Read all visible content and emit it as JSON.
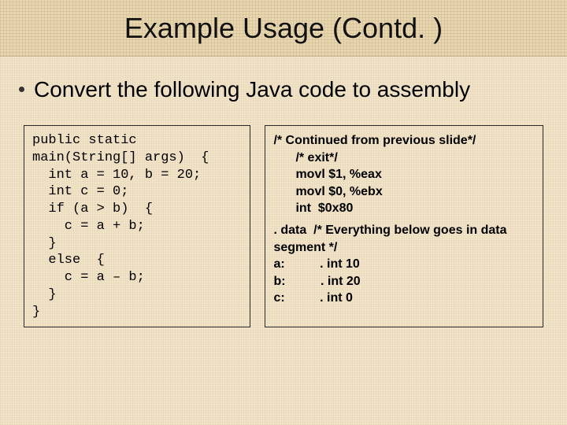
{
  "title": "Example Usage (Contd. )",
  "bullet": "Convert the following Java code to assembly",
  "leftCode": "public static\nmain(String[] args)  {\n  int a = 10, b = 20;\n  int c = 0;\n  if (a > b)  {\n    c = a + b;\n  }\n  else  {\n    c = a – b;\n  }\n}",
  "right": {
    "l1": "/* Continued from previous slide*/",
    "l2": "/* exit*/",
    "l3": "movl $1, %eax",
    "l4": "movl $0, %ebx",
    "l5": "int  $0x80",
    "l6": ". data  /* Everything below goes in data",
    "l7": "segment */",
    "l8": "a:          . int 10",
    "l9": "b:          . int 20",
    "l10": "c:          . int 0"
  }
}
